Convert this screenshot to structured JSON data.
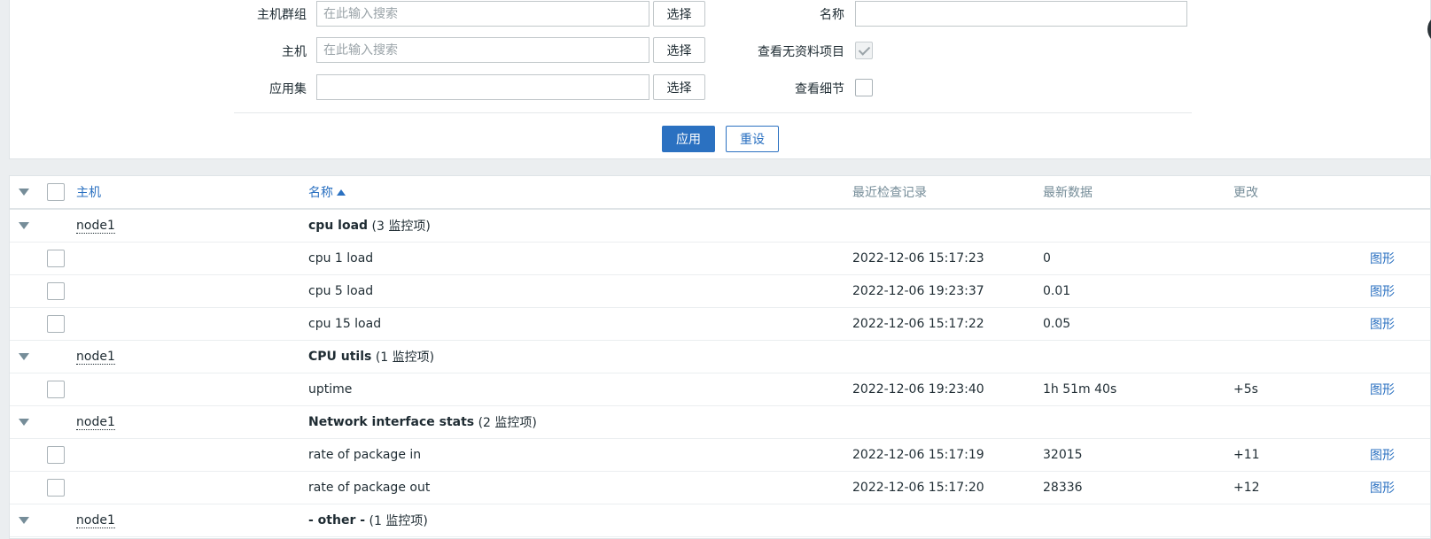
{
  "filter": {
    "host_groups": {
      "label": "主机群组",
      "placeholder": "在此输入搜索",
      "value": "",
      "select_label": "选择"
    },
    "hosts": {
      "label": "主机",
      "placeholder": "在此输入搜索",
      "value": "",
      "select_label": "选择"
    },
    "application": {
      "label": "应用集",
      "placeholder": "",
      "value": "",
      "select_label": "选择"
    },
    "name": {
      "label": "名称",
      "value": ""
    },
    "show_without_data": {
      "label": "查看无资料项目",
      "checked": true,
      "disabled": true
    },
    "show_details": {
      "label": "查看细节",
      "checked": false
    },
    "apply_label": "应用",
    "reset_label": "重设"
  },
  "table": {
    "headers": {
      "host": "主机",
      "name": "名称",
      "last_check": "最近检查记录",
      "last_value": "最新数据",
      "change": "更改"
    },
    "groups": [
      {
        "host": "node1",
        "app": "cpu load",
        "count": "(3 监控项)"
      },
      {
        "host": "node1",
        "app": "CPU utils",
        "count": "(1 监控项)"
      },
      {
        "host": "node1",
        "app": "Network interface stats",
        "count": "(2 监控项)"
      },
      {
        "host": "node1",
        "app": "- other -",
        "count": "(1 监控项)"
      }
    ],
    "items": [
      {
        "name": "cpu 1 load",
        "last_check": "2022-12-06 15:17:23",
        "last_value": "0",
        "change": "",
        "graph": "图形"
      },
      {
        "name": "cpu 5 load",
        "last_check": "2022-12-06 19:23:37",
        "last_value": "0.01",
        "change": "",
        "graph": "图形"
      },
      {
        "name": "cpu 15 load",
        "last_check": "2022-12-06 15:17:22",
        "last_value": "0.05",
        "change": "",
        "graph": "图形"
      },
      {
        "name": "uptime",
        "last_check": "2022-12-06 19:23:40",
        "last_value": "1h 51m 40s",
        "change": "+5s",
        "graph": "图形"
      },
      {
        "name": "rate of package in",
        "last_check": "2022-12-06 15:17:19",
        "last_value": "32015",
        "change": "+11",
        "graph": "图形"
      },
      {
        "name": "rate of package out",
        "last_check": "2022-12-06 15:17:20",
        "last_value": "28336",
        "change": "+12",
        "graph": "图形"
      }
    ]
  },
  "colors": {
    "link": "#2b71c1",
    "header_text": "#768d99",
    "apply_bg": "#2b71c1"
  }
}
